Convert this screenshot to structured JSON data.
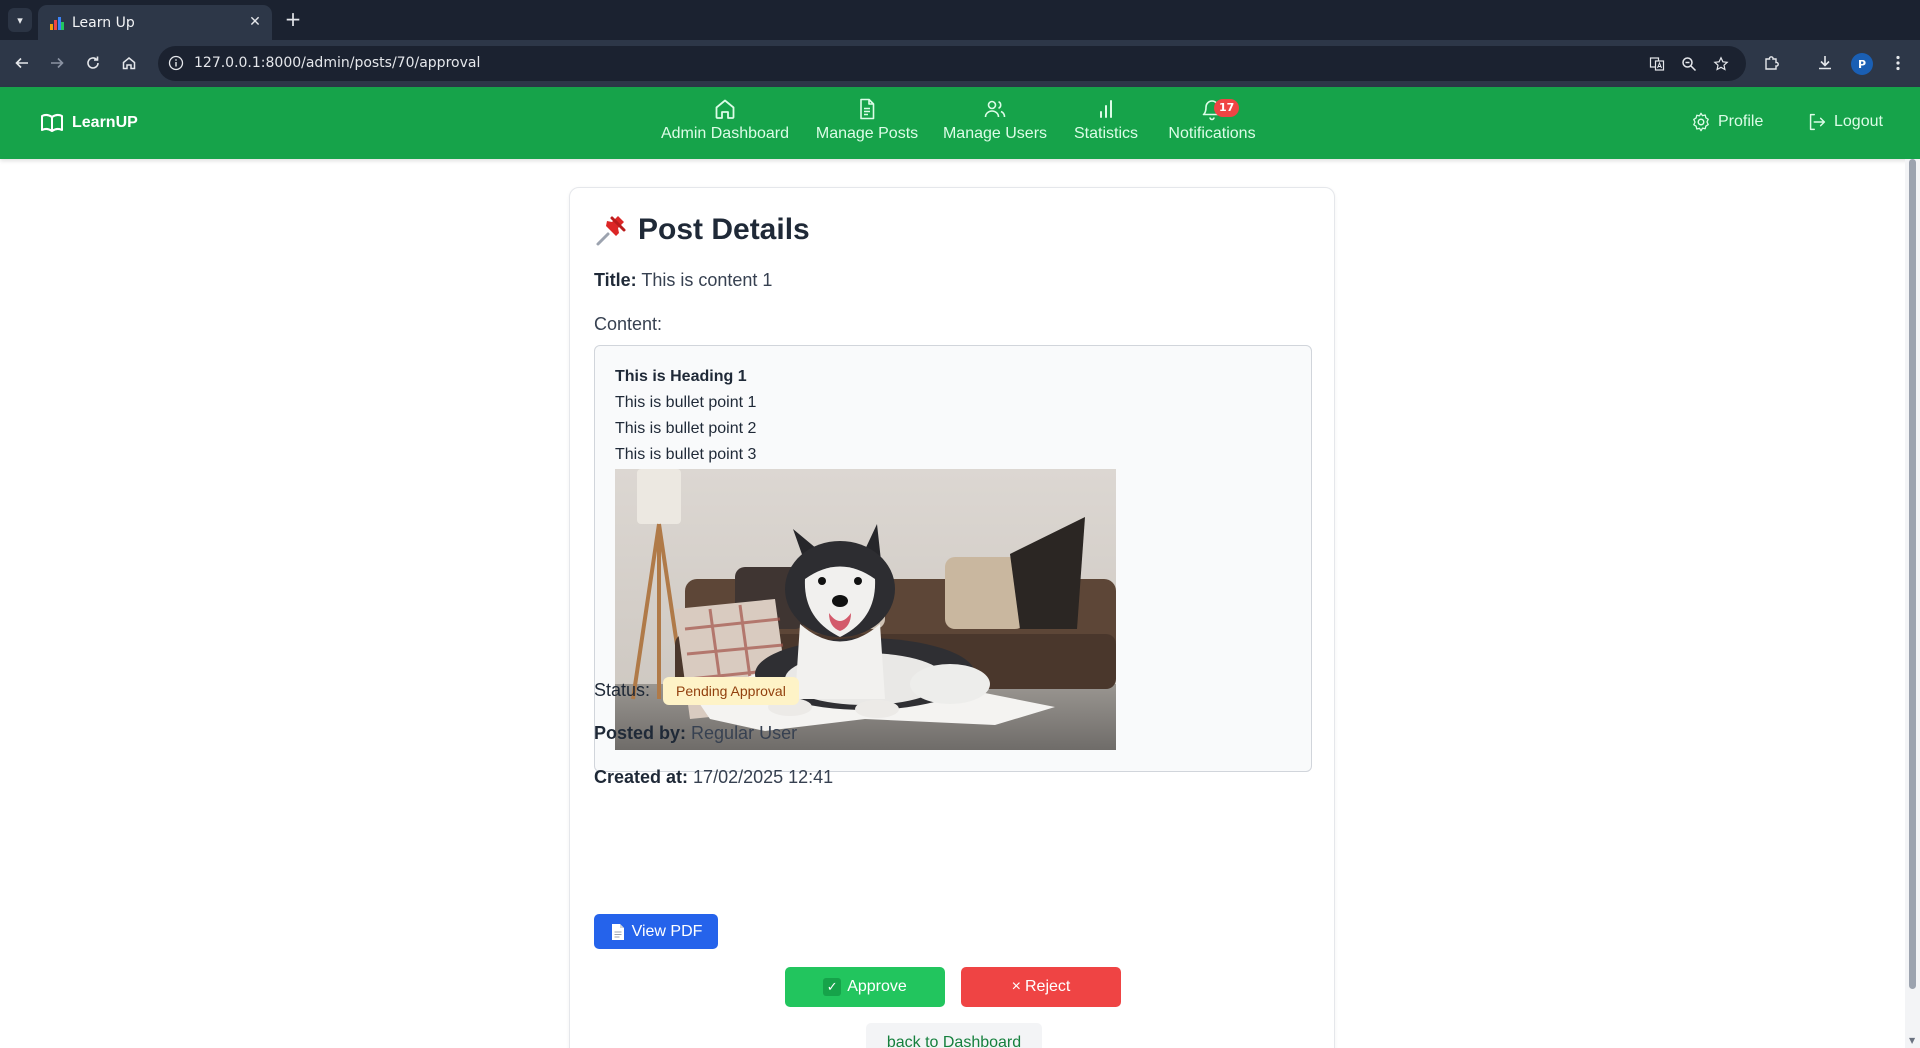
{
  "browser": {
    "tab_title": "Learn Up",
    "url": "127.0.0.1:8000/admin/posts/70/approval",
    "profile_initial": "P"
  },
  "navbar": {
    "brand": "LearnUP",
    "items": [
      {
        "label": "Admin Dashboard",
        "icon": "home-icon"
      },
      {
        "label": "Manage Posts",
        "icon": "document-icon"
      },
      {
        "label": "Manage Users",
        "icon": "users-icon"
      },
      {
        "label": "Statistics",
        "icon": "bar-chart-icon"
      },
      {
        "label": "Notifications",
        "icon": "bell-icon",
        "badge": "17"
      }
    ],
    "profile_label": "Profile",
    "logout_label": "Logout"
  },
  "post": {
    "heading": "Post Details",
    "title_label": "Title:",
    "title_value": "This is content 1",
    "content_label": "Content:",
    "content": {
      "heading": "This is Heading 1",
      "bullets": [
        "This is bullet point 1",
        "This is bullet point 2",
        "This is bullet point 3"
      ],
      "image_alt": "Husky dog lying on a rug in front of a sofa"
    },
    "status_label": "Status:",
    "status_value": "Pending Approval",
    "posted_by_label": "Posted by:",
    "posted_by_value": "Regular User",
    "created_at_label": "Created at:",
    "created_at_value": "17/02/2025 12:41"
  },
  "actions": {
    "view_pdf": "View PDF",
    "approve": "Approve",
    "reject": "Reject",
    "back": "back to Dashboard"
  },
  "colors": {
    "navbar": "#16a34a",
    "approve": "#22c55e",
    "reject": "#ef4444",
    "pdf": "#2563eb",
    "status_badge_bg": "#fef3c7"
  }
}
